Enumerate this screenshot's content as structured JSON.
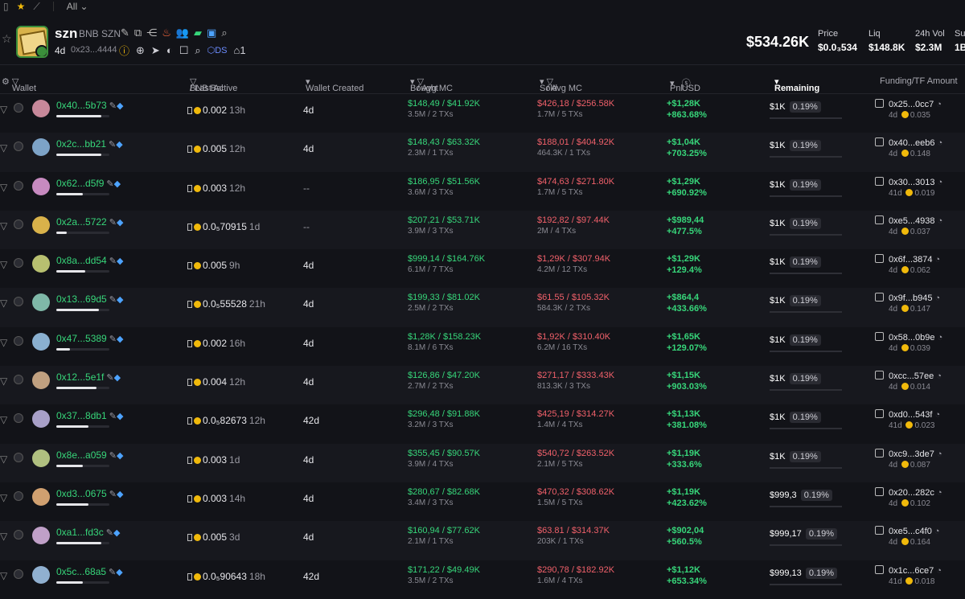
{
  "topbar": {
    "filter_label": "All"
  },
  "token": {
    "symbol": "szn",
    "name": "BNB SZN",
    "age": "4d",
    "address": "0x23...4444",
    "ds_label": "DS",
    "holders_count": "1"
  },
  "stats": {
    "market_cap": "$534.26K",
    "price_label": "Price",
    "price_value": "$0.0₃534",
    "liq_label": "Liq",
    "liq_value": "$148.8K",
    "vol_label": "24h Vol",
    "vol_value": "$2.3M",
    "supply_label": "Sup",
    "supply_value": "1B"
  },
  "columns": {
    "wallet": "Wallet",
    "bal": "BNB Bal",
    "last_active": "/ Last Active",
    "created": "Wallet Created",
    "bought": "Bought",
    "bought_mc": "/ Avg MC",
    "sold": "Sold",
    "sold_mc": "/ Avg MC",
    "pnl": "Pnl",
    "usd": "USD",
    "remaining": "Remaining",
    "funding": "Funding/TF Amount"
  },
  "rows": [
    {
      "addr": "0x40...5b73",
      "bal": "0.002",
      "active": "13h",
      "created": "4d",
      "bought": "$148,49 / $41.92K",
      "bought_sub": "3.5M / 2 TXs",
      "sold": "$426,18 / $256.58K",
      "sold_sub": "1.7M / 5 TXs",
      "pnl": "+$1,28K",
      "pnl_pct": "+863.68%",
      "rem": "$1K",
      "rem_pct": "0.19%",
      "fund": "0x25...0cc7",
      "fund_sub": "4d",
      "fund_amt": "0.035",
      "bar": 0.85,
      "color": "#c7889a"
    },
    {
      "addr": "0x2c...bb21",
      "bal": "0.005",
      "active": "12h",
      "created": "4d",
      "bought": "$148,43 / $63.32K",
      "bought_sub": "2.3M / 1 TXs",
      "sold": "$188,01 / $404.92K",
      "sold_sub": "464.3K / 1 TXs",
      "pnl": "+$1,04K",
      "pnl_pct": "+703.25%",
      "rem": "$1K",
      "rem_pct": "0.19%",
      "fund": "0x40...eeb6",
      "fund_sub": "4d",
      "fund_amt": "0.148",
      "bar": 0.85,
      "color": "#7da3c7"
    },
    {
      "addr": "0x62...d5f9",
      "bal": "0.003",
      "active": "12h",
      "created": "--",
      "bought": "$186,95 / $51.56K",
      "bought_sub": "3.6M / 3 TXs",
      "sold": "$474,63 / $271.80K",
      "sold_sub": "1.7M / 5 TXs",
      "pnl": "+$1,29K",
      "pnl_pct": "+690.92%",
      "rem": "$1K",
      "rem_pct": "0.19%",
      "fund": "0x30...3013",
      "fund_sub": "41d",
      "fund_amt": "0.019",
      "bar": 0.5,
      "color": "#c78ac0"
    },
    {
      "addr": "0x2a...5722",
      "bal": "0.0₅70915",
      "active": "1d",
      "created": "--",
      "bought": "$207,21 / $53.71K",
      "bought_sub": "3.9M / 3 TXs",
      "sold": "$192,82 / $97.44K",
      "sold_sub": "2M / 4 TXs",
      "pnl": "+$989,44",
      "pnl_pct": "+477.5%",
      "rem": "$1K",
      "rem_pct": "0.19%",
      "fund": "0xe5...4938",
      "fund_sub": "4d",
      "fund_amt": "0.037",
      "bar": 0.2,
      "color": "#d9b24a"
    },
    {
      "addr": "0x8a...dd54",
      "bal": "0.005",
      "active": "9h",
      "created": "4d",
      "bought": "$999,14 / $164.76K",
      "bought_sub": "6.1M / 7 TXs",
      "sold": "$1,29K / $307.94K",
      "sold_sub": "4.2M / 12 TXs",
      "pnl": "+$1,29K",
      "pnl_pct": "+129.4%",
      "rem": "$1K",
      "rem_pct": "0.19%",
      "fund": "0x6f...3874",
      "fund_sub": "4d",
      "fund_amt": "0.062",
      "bar": 0.55,
      "color": "#b8c070"
    },
    {
      "addr": "0x13...69d5",
      "bal": "0.0₅55528",
      "active": "21h",
      "created": "4d",
      "bought": "$199,33 / $81.02K",
      "bought_sub": "2.5M / 2 TXs",
      "sold": "$61.55 / $105.32K",
      "sold_sub": "584.3K / 2 TXs",
      "pnl": "+$864,4",
      "pnl_pct": "+433.66%",
      "rem": "$1K",
      "rem_pct": "0.19%",
      "fund": "0x9f...b945",
      "fund_sub": "4d",
      "fund_amt": "0.147",
      "bar": 0.8,
      "color": "#7fb8a8"
    },
    {
      "addr": "0x47...5389",
      "bal": "0.002",
      "active": "16h",
      "created": "4d",
      "bought": "$1,28K / $158.23K",
      "bought_sub": "8.1M / 6 TXs",
      "sold": "$1,92K / $310.40K",
      "sold_sub": "6.2M / 16 TXs",
      "pnl": "+$1,65K",
      "pnl_pct": "+129.07%",
      "rem": "$1K",
      "rem_pct": "0.19%",
      "fund": "0x58...0b9e",
      "fund_sub": "4d",
      "fund_amt": "0.039",
      "bar": 0.25,
      "color": "#8ab0d0"
    },
    {
      "addr": "0x12...5e1f",
      "bal": "0.004",
      "active": "12h",
      "created": "4d",
      "bought": "$126,86 / $47.20K",
      "bought_sub": "2.7M / 2 TXs",
      "sold": "$271,17 / $333.43K",
      "sold_sub": "813.3K / 3 TXs",
      "pnl": "+$1,15K",
      "pnl_pct": "+903.03%",
      "rem": "$1K",
      "rem_pct": "0.19%",
      "fund": "0xcc...57ee",
      "fund_sub": "4d",
      "fund_amt": "0.014",
      "bar": 0.75,
      "color": "#c0a080"
    },
    {
      "addr": "0x37...8db1",
      "bal": "0.0₅82673",
      "active": "12h",
      "created": "42d",
      "bought": "$296,48 / $91.88K",
      "bought_sub": "3.2M / 3 TXs",
      "sold": "$425,19 / $314.27K",
      "sold_sub": "1.4M / 4 TXs",
      "pnl": "+$1,13K",
      "pnl_pct": "+381.08%",
      "rem": "$1K",
      "rem_pct": "0.19%",
      "fund": "0xd0...543f",
      "fund_sub": "41d",
      "fund_amt": "0.023",
      "bar": 0.6,
      "color": "#a8a0c8"
    },
    {
      "addr": "0x8e...a059",
      "bal": "0.003",
      "active": "1d",
      "created": "4d",
      "bought": "$355,45 / $90.57K",
      "bought_sub": "3.9M / 4 TXs",
      "sold": "$540,72 / $263.52K",
      "sold_sub": "2.1M / 5 TXs",
      "pnl": "+$1,19K",
      "pnl_pct": "+333.6%",
      "rem": "$1K",
      "rem_pct": "0.19%",
      "fund": "0xc9...3de7",
      "fund_sub": "4d",
      "fund_amt": "0.087",
      "bar": 0.5,
      "color": "#b0c080"
    },
    {
      "addr": "0xd3...0675",
      "bal": "0.003",
      "active": "14h",
      "created": "4d",
      "bought": "$280,67 / $82.68K",
      "bought_sub": "3.4M / 3 TXs",
      "sold": "$470,32 / $308.62K",
      "sold_sub": "1.5M / 5 TXs",
      "pnl": "+$1,19K",
      "pnl_pct": "+423.62%",
      "rem": "$999,3",
      "rem_pct": "0.19%",
      "fund": "0x20...282c",
      "fund_sub": "4d",
      "fund_amt": "0.102",
      "bar": 0.6,
      "color": "#d0a070"
    },
    {
      "addr": "0xa1...fd3c",
      "bal": "0.005",
      "active": "3d",
      "created": "4d",
      "bought": "$160,94 / $77.62K",
      "bought_sub": "2.1M / 1 TXs",
      "sold": "$63.81 / $314.37K",
      "sold_sub": "203K / 1 TXs",
      "pnl": "+$902,04",
      "pnl_pct": "+560.5%",
      "rem": "$999,17",
      "rem_pct": "0.19%",
      "fund": "0xe5...c4f0",
      "fund_sub": "4d",
      "fund_amt": "0.164",
      "bar": 0.85,
      "color": "#c0a0c8"
    },
    {
      "addr": "0x5c...68a5",
      "bal": "0.0₅90643",
      "active": "18h",
      "created": "42d",
      "bought": "$171,22 / $49.49K",
      "bought_sub": "3.5M / 2 TXs",
      "sold": "$290,78 / $182.92K",
      "sold_sub": "1.6M / 4 TXs",
      "pnl": "+$1,12K",
      "pnl_pct": "+653.34%",
      "rem": "$999,13",
      "rem_pct": "0.19%",
      "fund": "0x1c...6ce7",
      "fund_sub": "41d",
      "fund_amt": "0.018",
      "bar": 0.5,
      "color": "#90b0d0"
    }
  ]
}
